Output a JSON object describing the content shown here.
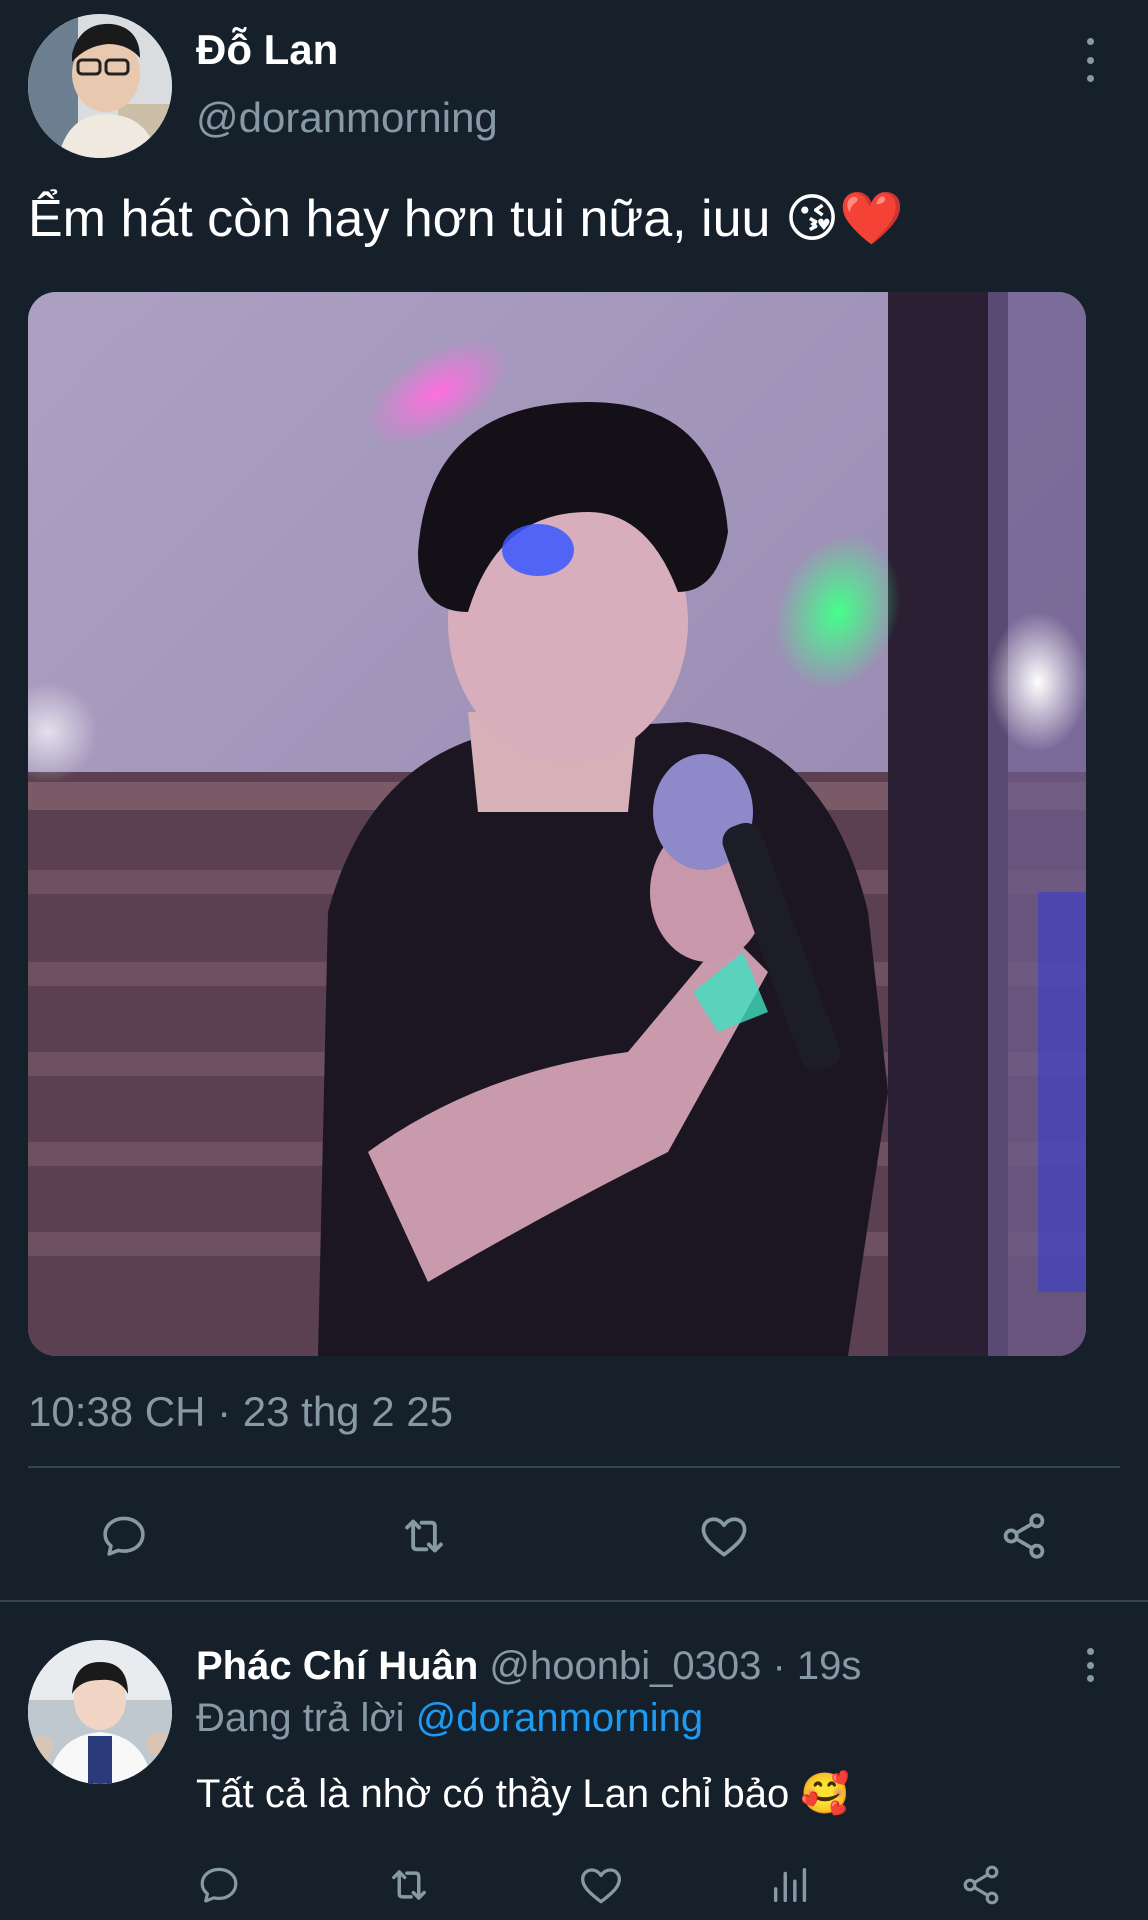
{
  "tweet": {
    "author_name": "Đỗ Lan",
    "author_handle": "@doranmorning",
    "text": "Ểm hát còn hay hơn tui nữa, iuu 😘❤️",
    "timestamp": "10:38 CH · 23 thg 2 25",
    "actions": {
      "reply_icon": "comment-bubble-icon",
      "retweet_icon": "retweet-icon",
      "like_icon": "heart-icon",
      "share_icon": "share-icon"
    }
  },
  "reply": {
    "author_name": "Phác Chí Huân",
    "author_handle": "@hoonbi_0303",
    "time_sep": " · ",
    "time": "19s",
    "replying_label": "Đang trả lời",
    "replying_to": "@doranmorning",
    "text": "Tất cả là nhờ có thầy Lan chỉ bảo 🥰",
    "actions": {
      "reply_icon": "comment-bubble-icon",
      "retweet_icon": "retweet-icon",
      "like_icon": "heart-icon",
      "analytics_icon": "analytics-bars-icon",
      "share_icon": "share-icon"
    }
  },
  "colors": {
    "background": "#15202b",
    "primary_text": "#ffffff",
    "secondary_text": "#8899a6",
    "link": "#1d9bf0",
    "divider": "#38444d"
  }
}
